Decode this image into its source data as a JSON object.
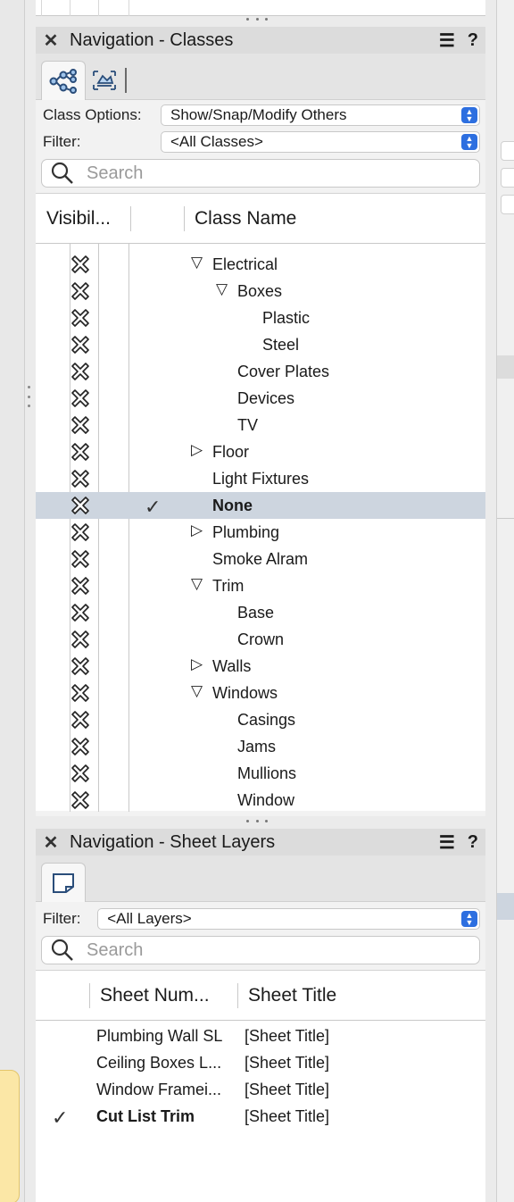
{
  "classes_panel": {
    "title": "Navigation - Classes",
    "class_options_label": "Class Options:",
    "class_options_value": "Show/Snap/Modify Others",
    "filter_label": "Filter:",
    "filter_value": "<All Classes>",
    "search_placeholder": "Search",
    "columns": {
      "visibility": "Visibil...",
      "class_name": "Class Name"
    },
    "rows": [
      {
        "name": "Electrical",
        "tree": "expanded",
        "level": 1,
        "active": false
      },
      {
        "name": "Boxes",
        "tree": "expanded",
        "level": 2,
        "active": false
      },
      {
        "name": "Plastic",
        "tree": "leaf",
        "level": 3,
        "active": false
      },
      {
        "name": "Steel",
        "tree": "leaf",
        "level": 3,
        "active": false
      },
      {
        "name": "Cover Plates",
        "tree": "leaf",
        "level": 2,
        "active": false
      },
      {
        "name": "Devices",
        "tree": "leaf",
        "level": 2,
        "active": false
      },
      {
        "name": "TV",
        "tree": "leaf",
        "level": 2,
        "active": false
      },
      {
        "name": "Floor",
        "tree": "collapsed",
        "level": 1,
        "active": false
      },
      {
        "name": "Light Fixtures",
        "tree": "leaf",
        "level": 1,
        "active": false
      },
      {
        "name": "None",
        "tree": "leaf",
        "level": 1,
        "active": true
      },
      {
        "name": "Plumbing",
        "tree": "collapsed",
        "level": 1,
        "active": false
      },
      {
        "name": "Smoke Alram",
        "tree": "leaf",
        "level": 1,
        "active": false
      },
      {
        "name": "Trim",
        "tree": "expanded",
        "level": 1,
        "active": false
      },
      {
        "name": "Base",
        "tree": "leaf",
        "level": 2,
        "active": false
      },
      {
        "name": "Crown",
        "tree": "leaf",
        "level": 2,
        "active": false
      },
      {
        "name": "Walls",
        "tree": "collapsed",
        "level": 1,
        "active": false
      },
      {
        "name": "Windows",
        "tree": "expanded",
        "level": 1,
        "active": false
      },
      {
        "name": "Casings",
        "tree": "leaf",
        "level": 2,
        "active": false
      },
      {
        "name": "Jams",
        "tree": "leaf",
        "level": 2,
        "active": false
      },
      {
        "name": "Mullions",
        "tree": "leaf",
        "level": 2,
        "active": false
      },
      {
        "name": "Window",
        "tree": "leaf",
        "level": 2,
        "active": false
      }
    ]
  },
  "sheet_layers_panel": {
    "title": "Navigation - Sheet Layers",
    "filter_label": "Filter:",
    "filter_value": "<All Layers>",
    "search_placeholder": "Search",
    "columns": {
      "sheet_number": "Sheet Num...",
      "sheet_title": "Sheet Title"
    },
    "rows": [
      {
        "number": "Plumbing Wall SL",
        "title": "[Sheet Title]",
        "active": false
      },
      {
        "number": "Ceiling Boxes L...",
        "title": "[Sheet Title]",
        "active": false
      },
      {
        "number": "Window Framei...",
        "title": "[Sheet Title]",
        "active": false
      },
      {
        "number": "Cut List Trim",
        "title": "[Sheet Title]",
        "active": true
      }
    ]
  },
  "colors": {
    "accent": "#2d6fe0",
    "selected_row": "#cdd5df"
  },
  "icons": [
    "close-icon",
    "menu-icon",
    "help-icon",
    "class-hierarchy-icon",
    "class-thumbnail-icon",
    "search-icon",
    "visibility-icon",
    "check-icon",
    "sheet-layer-icon"
  ]
}
